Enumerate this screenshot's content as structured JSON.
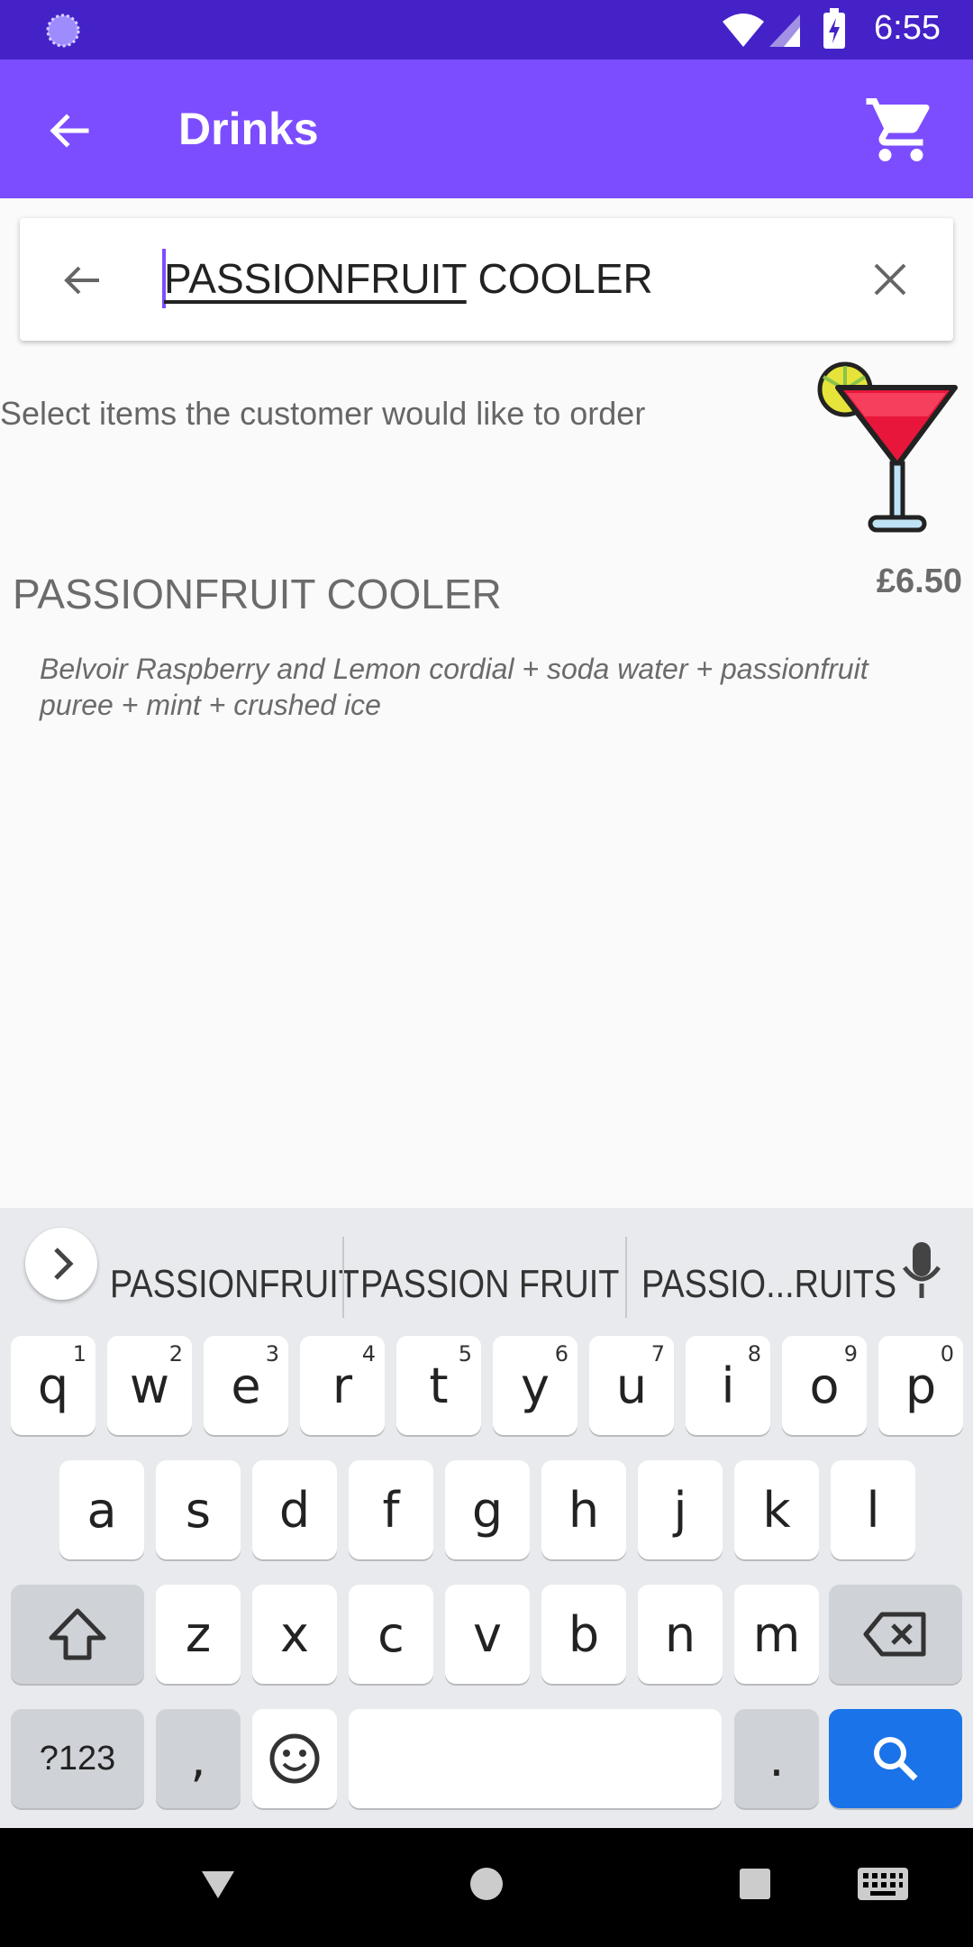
{
  "status_bar": {
    "time": "6:55"
  },
  "app_bar": {
    "title": "Drinks"
  },
  "search": {
    "query_underlined": "PASSIONFRUIT",
    "query_rest": " COOLER"
  },
  "content": {
    "subtitle": "Select items the customer would like to order",
    "item": {
      "name": "PASSIONFRUIT COOLER",
      "price": "£6.50",
      "description": "Belvoir Raspberry and Lemon cordial + soda water + passionfruit puree + mint + crushed ice"
    }
  },
  "keyboard": {
    "suggestions": [
      "PASSIONFRUIT",
      "PASSION FRUIT",
      "PASSIO...RUITS"
    ],
    "row1": [
      {
        "k": "q",
        "n": "1"
      },
      {
        "k": "w",
        "n": "2"
      },
      {
        "k": "e",
        "n": "3"
      },
      {
        "k": "r",
        "n": "4"
      },
      {
        "k": "t",
        "n": "5"
      },
      {
        "k": "y",
        "n": "6"
      },
      {
        "k": "u",
        "n": "7"
      },
      {
        "k": "i",
        "n": "8"
      },
      {
        "k": "o",
        "n": "9"
      },
      {
        "k": "p",
        "n": "0"
      }
    ],
    "row2": [
      "a",
      "s",
      "d",
      "f",
      "g",
      "h",
      "j",
      "k",
      "l"
    ],
    "row3": [
      "z",
      "x",
      "c",
      "v",
      "b",
      "n",
      "m"
    ],
    "symbols_label": "?123",
    "comma": ",",
    "period": "."
  }
}
